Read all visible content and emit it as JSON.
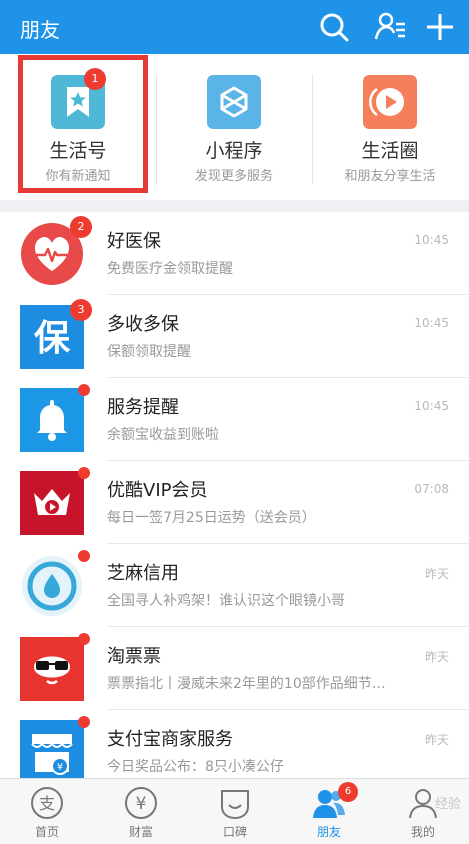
{
  "header": {
    "title": "朋友",
    "icons": [
      "search-icon",
      "contacts-icon",
      "add-icon"
    ],
    "bg_color": "#1f93e8"
  },
  "quick_items": [
    {
      "label": "生活号",
      "desc": "你有新通知",
      "badge": "1",
      "icon": "bookmark-star-icon",
      "color": "#4fb8d7"
    },
    {
      "label": "小程序",
      "desc": "发现更多服务",
      "icon": "mini-program-icon",
      "color": "#5ab4e8"
    },
    {
      "label": "生活圈",
      "desc": "和朋友分享生活",
      "icon": "play-circle-icon",
      "color": "#f57f5b"
    }
  ],
  "messages": [
    {
      "name": "好医保",
      "sub": "免费医疗金领取提醒",
      "time": "10:45",
      "badge": "2"
    },
    {
      "name": "多收多保",
      "sub": "保额领取提醒",
      "time": "10:45",
      "badge": "3"
    },
    {
      "name": "服务提醒",
      "sub": "余额宝收益到账啦",
      "time": "10:45"
    },
    {
      "name": "优酷VIP会员",
      "sub": "每日一签7月25日运势（送会员）",
      "time": "07:08"
    },
    {
      "name": "芝麻信用",
      "sub": "全国寻人补鸡架！谁认识这个眼镜小哥",
      "time": "昨天"
    },
    {
      "name": "淘票票",
      "sub": "票票指北丨漫威未来2年里的10部作品细节…",
      "time": "昨天"
    },
    {
      "name": "支付宝商家服务",
      "sub": "今日奖品公布：8只小凑公仔",
      "time": "昨天"
    }
  ],
  "tabs": [
    {
      "label": "首页",
      "icon": "alipay-home-icon"
    },
    {
      "label": "财富",
      "icon": "yuan-icon"
    },
    {
      "label": "口碑",
      "icon": "koubei-icon"
    },
    {
      "label": "朋友",
      "icon": "friends-icon",
      "badge": "6",
      "active": true
    },
    {
      "label": "我的",
      "icon": "profile-icon"
    }
  ],
  "watermark": "经验",
  "accent_color": "#1f93e8",
  "badge_color": "#ee3b2f"
}
